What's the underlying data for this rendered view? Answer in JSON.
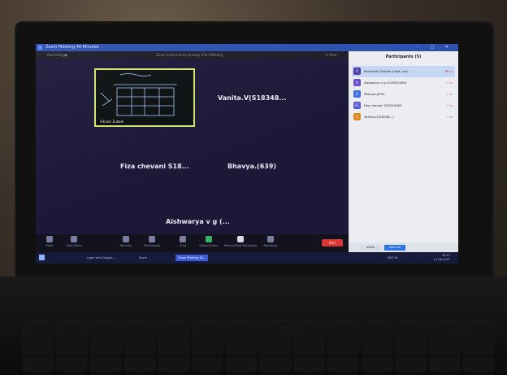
{
  "window": {
    "title": "Zoom Meeting 40-Minutes"
  },
  "infobar": {
    "view_label": "Recording ●",
    "meeting_info": "Zoom is blurred for privacy (Pro) Meeting",
    "view_button": "☰ View"
  },
  "shared_tile": {
    "name": "Vikram Zubale"
  },
  "tiles": {
    "vanita": "Vanita.V(S18348...",
    "fiza": "Fiza chevani S18...",
    "bhavya": "Bhavya.(639)",
    "aishwarya": "Aishwarya v g (..."
  },
  "toolbar": {
    "items": [
      "Mute",
      "Start Video",
      "Security",
      "Participants",
      "Chat",
      "Share Screen",
      "Record/Stop Recording",
      "Reactions"
    ],
    "participants_count": "4",
    "end_label": "End"
  },
  "panel": {
    "title": "Participants (5)",
    "participants": [
      {
        "name": "Ravikanth Zubale (Host, me)",
        "initial": "R",
        "color": "#4a3ea8",
        "icons": "⊕ ̴̸ ▭"
      },
      {
        "name": "Aishwarya v g (S18352460)",
        "initial": "A",
        "color": "#6a4fd1",
        "icons": "̸ ▭"
      },
      {
        "name": "Bhavya.(639)",
        "initial": "B",
        "color": "#3b6fe0",
        "icons": "̸ ▭"
      },
      {
        "name": "Fiza chevani S18349460",
        "initial": "FC",
        "color": "#5a56d8",
        "icons": "̸ ▭"
      },
      {
        "name": "Vanita.V(S18348...)",
        "initial": "V",
        "color": "#e08a1e",
        "icons": "̸ ▭"
      }
    ],
    "invite_label": "Invite",
    "mute_all_label": "Mute All"
  },
  "taskbar": {
    "tasks": [
      "Login with Google...",
      "Zoom",
      "Zoom Meeting 40..."
    ],
    "time": "16:47",
    "date": "14-06-2021",
    "lang": "ENG IN"
  },
  "colors": {
    "gallery_bg": "#1b1838",
    "panel_bg": "#ecedf3",
    "titlebar": "#2d4fb0",
    "end_button": "#d93636",
    "active_border": "#cfe36a"
  }
}
